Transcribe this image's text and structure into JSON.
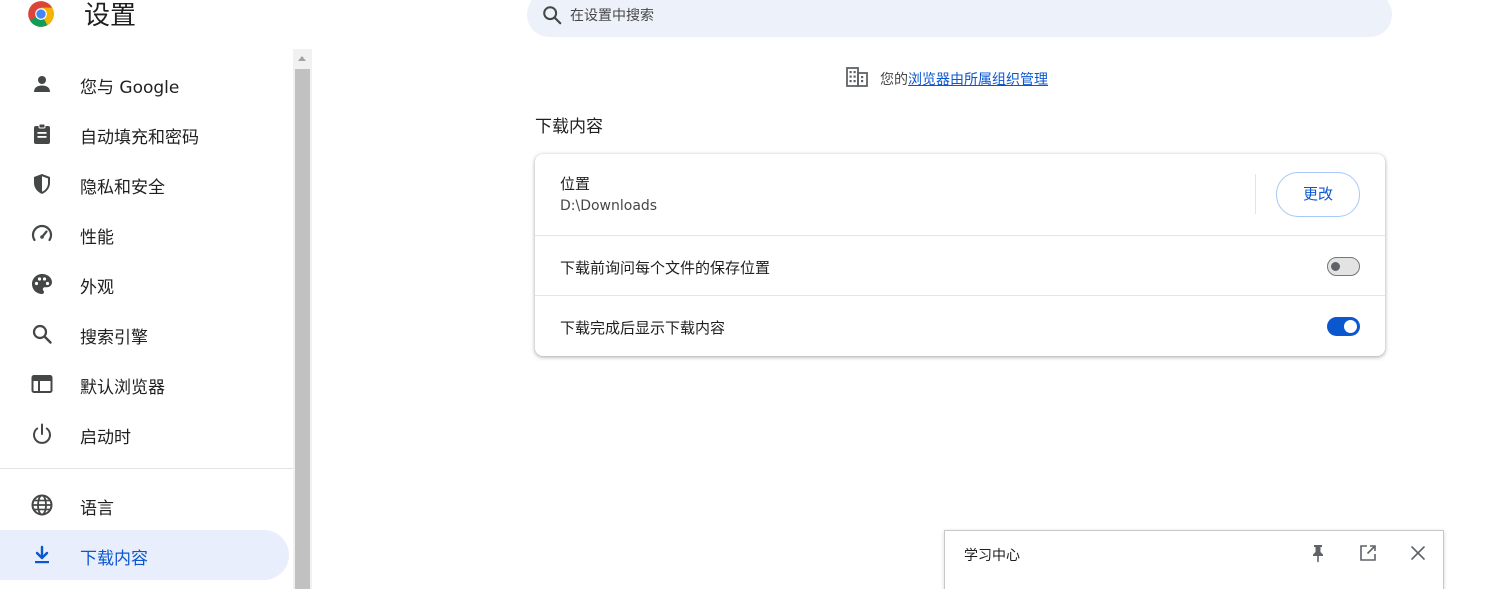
{
  "header": {
    "title": "设置",
    "logo_icon": "chrome-logo",
    "search": {
      "placeholder": "在设置中搜索",
      "icon": "search-icon"
    }
  },
  "sidebar": {
    "items": [
      {
        "label": "您与 Google",
        "icon": "person-icon"
      },
      {
        "label": "自动填充和密码",
        "icon": "clipboard-icon"
      },
      {
        "label": "隐私和安全",
        "icon": "shield-icon"
      },
      {
        "label": "性能",
        "icon": "speedometer-icon"
      },
      {
        "label": "外观",
        "icon": "palette-icon"
      },
      {
        "label": "搜索引擎",
        "icon": "search-icon"
      },
      {
        "label": "默认浏览器",
        "icon": "browser-window-icon"
      },
      {
        "label": "启动时",
        "icon": "power-icon"
      },
      {
        "label": "语言",
        "icon": "globe-icon"
      },
      {
        "label": "下载内容",
        "icon": "download-icon",
        "active": true
      }
    ]
  },
  "managed_notice": {
    "prefix": "您的",
    "link": "浏览器由所属组织管理",
    "icon": "building-icon"
  },
  "main": {
    "section_title": "下载内容",
    "location": {
      "label": "位置",
      "path": "D:\\Downloads",
      "button": "更改"
    },
    "ask_where_to_save": {
      "label": "下载前询问每个文件的保存位置",
      "enabled": false
    },
    "show_downloads_when_done": {
      "label": "下载完成后显示下载内容",
      "enabled": true
    }
  },
  "learning_panel": {
    "title": "学习中心",
    "icons": [
      "pin-icon",
      "open-in-new-icon",
      "close-icon"
    ]
  },
  "colors": {
    "accent": "#0b57d0",
    "active_nav_bg": "#e8eefb",
    "search_bg": "#edf2fa"
  }
}
